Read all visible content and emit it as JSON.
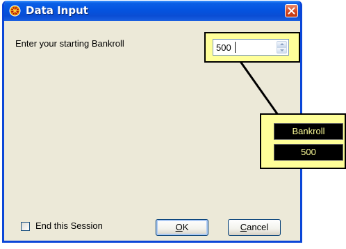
{
  "window": {
    "title": "Data Input",
    "icon": "roulette-wheel-icon",
    "titlebar_color": "#0a5fe6",
    "close_icon": "close-icon"
  },
  "form": {
    "prompt": "Enter your starting Bankroll",
    "bankroll_value": "500"
  },
  "footer": {
    "checkbox_label": "End this Session",
    "checkbox_checked": false,
    "ok_label": "OK",
    "ok_mnemonic": "O",
    "ok_rest": "K",
    "cancel_label": "Cancel",
    "cancel_mnemonic": "C",
    "cancel_rest": "ancel"
  },
  "callout": {
    "header": "Bankroll",
    "value": "500",
    "background": "#ffff99"
  }
}
